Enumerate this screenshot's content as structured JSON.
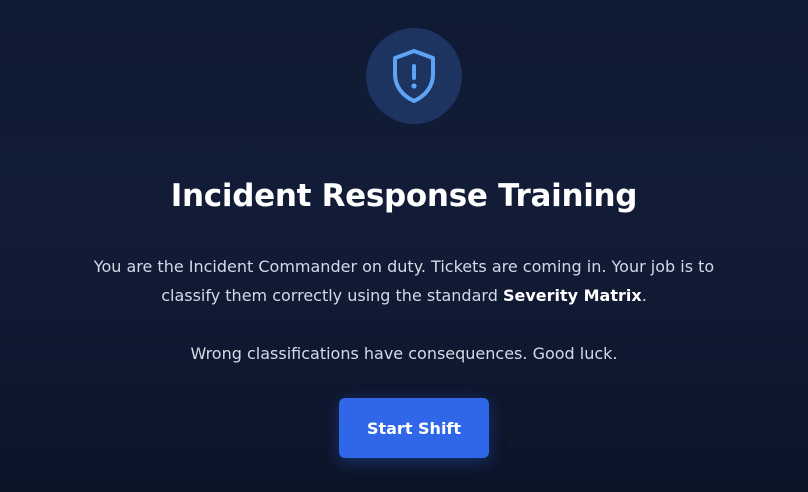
{
  "hero": {
    "icon": "shield-alert-icon",
    "accent": "#5fa3f5",
    "icon_bg": "#1d3461"
  },
  "title": "Incident Response Training",
  "description": {
    "part1": "You are the Incident Commander on duty. Tickets are coming in. Your job is to classify them correctly using the standard ",
    "highlight": "Severity Matrix",
    "part2": "."
  },
  "warning": "Wrong classifications have consequences. Good luck.",
  "start_button": {
    "label": "Start Shift",
    "color": "#2f67e8"
  }
}
